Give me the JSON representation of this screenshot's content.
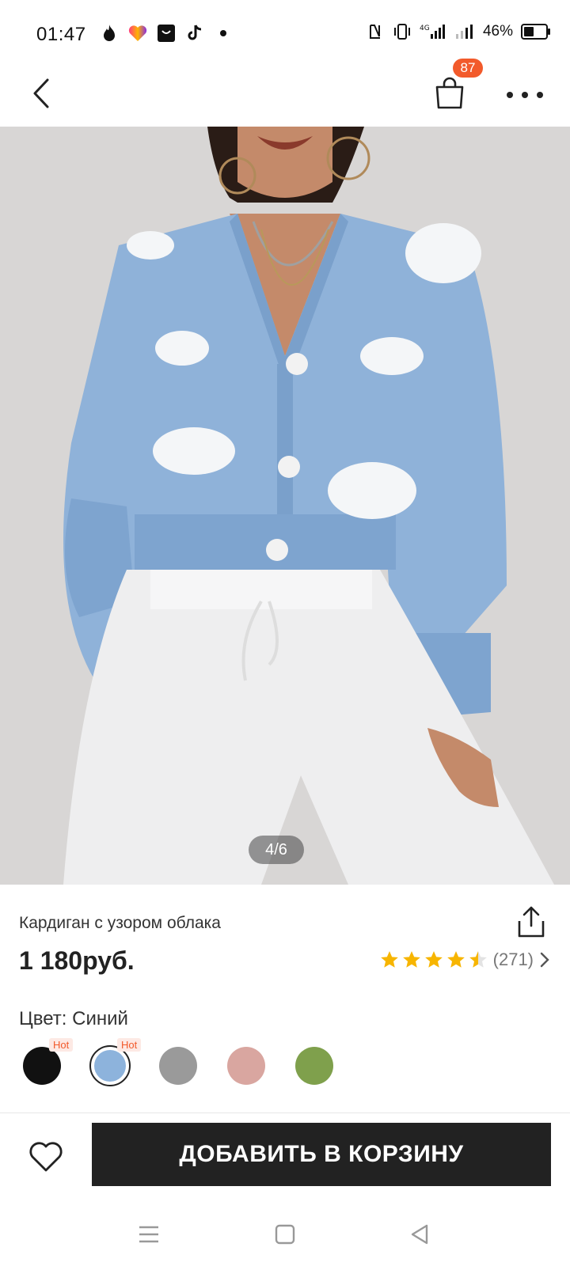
{
  "status_bar": {
    "time": "01:47",
    "network": "4G",
    "battery_text": "46%",
    "battery_level": 0.46,
    "icons": [
      "flame-icon",
      "heart-app-icon",
      "shop-app-icon",
      "tiktok-icon",
      "dot-icon",
      "nfc-icon",
      "vibrate-icon",
      "signal-icon",
      "signal-icon",
      "battery-icon"
    ]
  },
  "header": {
    "cart_count": "87",
    "back_icon": "chevron-left-icon",
    "bag_icon": "shopping-bag-icon",
    "more_icon": "more-dots-icon"
  },
  "product": {
    "image_counter": "4/6",
    "title": "Кардиган с узором облака",
    "price": "1 180руб.",
    "rating_value": 4.5,
    "review_count": "(271)",
    "color_label": "Цвет: Синий",
    "swatches": [
      {
        "name": "black",
        "color": "#111111",
        "hot": "Hot"
      },
      {
        "name": "blue",
        "color": "#8db3dc",
        "hot": "Hot",
        "selected": true
      },
      {
        "name": "grey",
        "color": "#9a9a9a",
        "hot": ""
      },
      {
        "name": "pink",
        "color": "#d9a6a0",
        "hot": ""
      },
      {
        "name": "green",
        "color": "#7fa04c",
        "hot": ""
      }
    ]
  },
  "actions": {
    "add_to_cart": "ДОБАВИТЬ В КОРЗИНУ"
  },
  "colors": {
    "accent": "#f25a2b",
    "button_bg": "#222222",
    "star": "#f7b500"
  }
}
